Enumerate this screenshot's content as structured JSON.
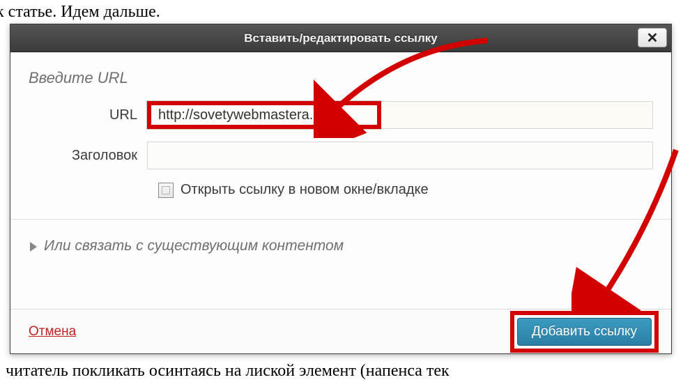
{
  "background": {
    "top_text": "к статье. Идем дальше.",
    "bottom_text": "читатель покликать  осинтаясь на лиской элемент (напенса тек"
  },
  "dialog": {
    "title": "Вставить/редактировать ссылку",
    "close_symbol": "✕",
    "section_heading": "Введите URL",
    "url_label": "URL",
    "url_value": "http://sovetywebmastera.ru",
    "title_label": "Заголовок",
    "title_value": "",
    "checkbox_label": "Открыть ссылку в новом окне/вкладке",
    "link_existing": "Или связать с существующим контентом",
    "cancel_label": "Отмена",
    "submit_label": "Добавить ссылку"
  },
  "annotations": {
    "arrow_color": "#d30000"
  }
}
